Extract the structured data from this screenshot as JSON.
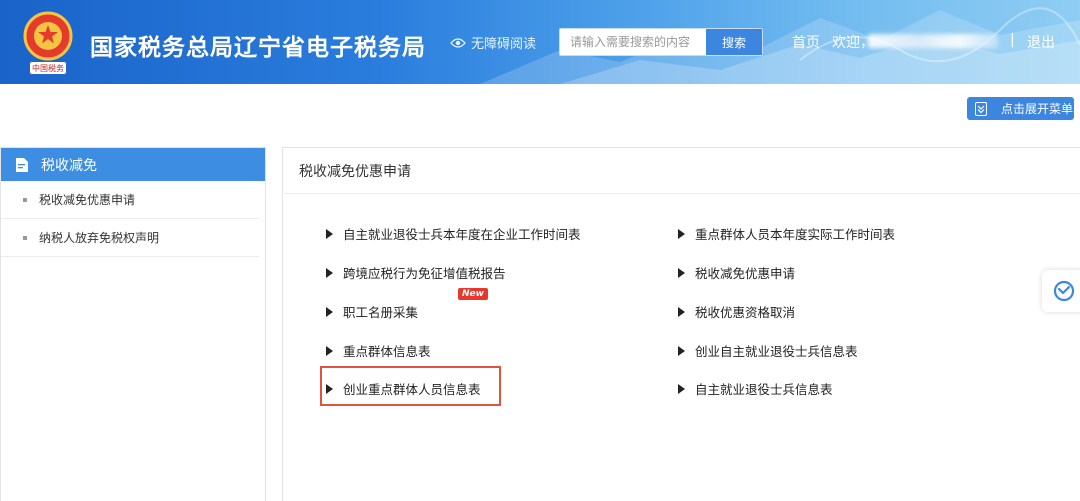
{
  "header": {
    "title": "国家税务总局辽宁省电子税务局",
    "accessibility_label": "无障碍阅读",
    "search_placeholder": "请输入需要搜索的内容",
    "search_button": "搜索",
    "nav_home": "首页",
    "nav_welcome": "欢迎，",
    "nav_separator": "|",
    "nav_logout": "退出"
  },
  "expand_menu_label": "点击展开菜单",
  "sidebar": {
    "title": "税收减免",
    "items": [
      {
        "label": "税收减免优惠申请"
      },
      {
        "label": "纳税人放弃免税权声明"
      }
    ]
  },
  "panel": {
    "title": "税收减免优惠申请",
    "links": [
      {
        "label": "自主就业退役士兵本年度在企业工作时间表"
      },
      {
        "label": "重点群体人员本年度实际工作时间表"
      },
      {
        "label": "跨境应税行为免征增值税报告"
      },
      {
        "label": "税收减免优惠申请"
      },
      {
        "label": "职工名册采集",
        "badge": "New"
      },
      {
        "label": "税收优惠资格取消"
      },
      {
        "label": "重点群体信息表"
      },
      {
        "label": "创业自主就业退役士兵信息表"
      },
      {
        "label": "创业重点群体人员信息表"
      },
      {
        "label": "自主就业退役士兵信息表"
      }
    ]
  },
  "colors": {
    "primary_blue": "#3d86e0",
    "sidebar_header": "#3d8ee3",
    "highlight_border": "#e0543d",
    "new_badge": "#e8382c"
  }
}
